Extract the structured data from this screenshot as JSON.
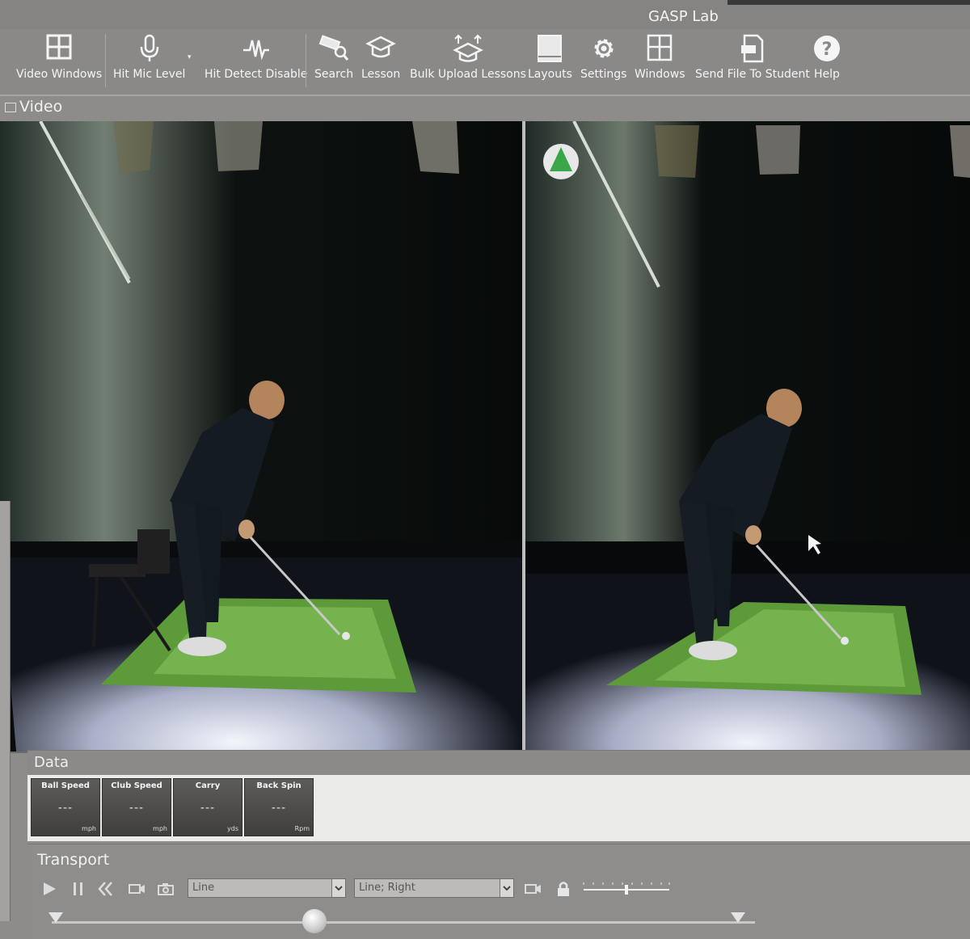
{
  "window": {
    "title": "GASP Lab"
  },
  "ribbon": {
    "buttons": [
      {
        "label": "Video Windows",
        "icon": "video-windows-icon"
      },
      {
        "label": "Hit Mic Level",
        "icon": "microphone-icon"
      },
      {
        "label": "Hit Detect Disable",
        "icon": "hit-detect-icon"
      },
      {
        "label": "Search",
        "icon": "search-icon"
      },
      {
        "label": "Lesson",
        "icon": "lesson-icon"
      },
      {
        "label": "Bulk Upload Lessons",
        "icon": "bulk-upload-icon"
      },
      {
        "label": "Layouts",
        "icon": "layouts-icon"
      },
      {
        "label": "Settings",
        "icon": "gear-icon"
      },
      {
        "label": "Windows",
        "icon": "windows-icon"
      },
      {
        "label": "Send File To Student",
        "icon": "send-file-icon"
      },
      {
        "label": "Help",
        "icon": "help-icon"
      }
    ]
  },
  "video": {
    "header": "Video"
  },
  "data": {
    "header": "Data",
    "tiles": [
      {
        "title": "Ball Speed",
        "value": "---",
        "unit": "mph"
      },
      {
        "title": "Club Speed",
        "value": "---",
        "unit": "mph"
      },
      {
        "title": "Carry",
        "value": "---",
        "unit": "yds"
      },
      {
        "title": "Back Spin",
        "value": "---",
        "unit": "Rpm"
      }
    ]
  },
  "transport": {
    "header": "Transport",
    "draw_tool_select": "Line",
    "overlay_select": "Line; Right"
  },
  "colors": {
    "ribbon_bg": "#8a8988",
    "mat_green": "#5c9a3a",
    "panel_light": "#ebebea"
  }
}
